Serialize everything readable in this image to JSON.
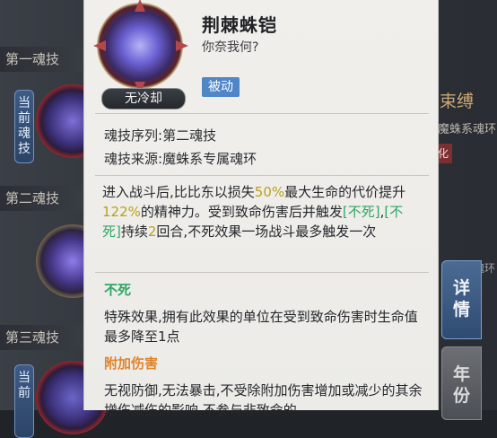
{
  "left_panel": {
    "rows": [
      {
        "label": "第一魂技"
      },
      {
        "label": "第二魂技"
      },
      {
        "label": "第三魂技"
      }
    ],
    "current_tag_1": "当\n前\n魂\n技",
    "current_tag_2": "当\n前"
  },
  "right_panel": {
    "title": "束缚",
    "subtitle": "魔蛛系魂环",
    "badge": "化",
    "subtitle2": "魂环",
    "tabs": [
      {
        "label": "详\n情"
      },
      {
        "label": "年\n份"
      }
    ]
  },
  "tooltip": {
    "icon_name": "soul-skill-icon",
    "no_cooldown": "无冷却",
    "name": "荆棘蛛铠",
    "quote": "你奈我何?",
    "type_tag": "被动",
    "sequence_key": "魂技序列:",
    "sequence_val": "第二魂技",
    "source_key": "魂技来源:",
    "source_val": "魔蛛系专属魂环",
    "description_parts": {
      "p1": "进入战斗后,比比东以损失",
      "p1_hl": "50%",
      "p2": "最大生命的代价提升",
      "p2_hl": "122%",
      "p3": "的精神力。受到致命伤害后并触发",
      "p3_hl1": "[不死]",
      "p3_sep": ",",
      "p3_hl2": "[不死]",
      "p4": "持续",
      "p4_hl": "2",
      "p5": "回合,不死效果一场战斗最多触发一次"
    },
    "section1_title": "不死",
    "section1_text": "特殊效果,拥有此效果的单位在受到致命伤害时生命值最多降至1点",
    "section2_title": "附加伤害",
    "section2_text": "无视防御,无法暴击,不受除附加伤害增加或减少的其余增伤减伤的影响,不参与非致命的"
  },
  "colors": {
    "highlight_yellow": "#b9a11a",
    "highlight_green": "#2ea764",
    "section_orange": "#e0842a",
    "passive_blue": "#4f86c7"
  }
}
